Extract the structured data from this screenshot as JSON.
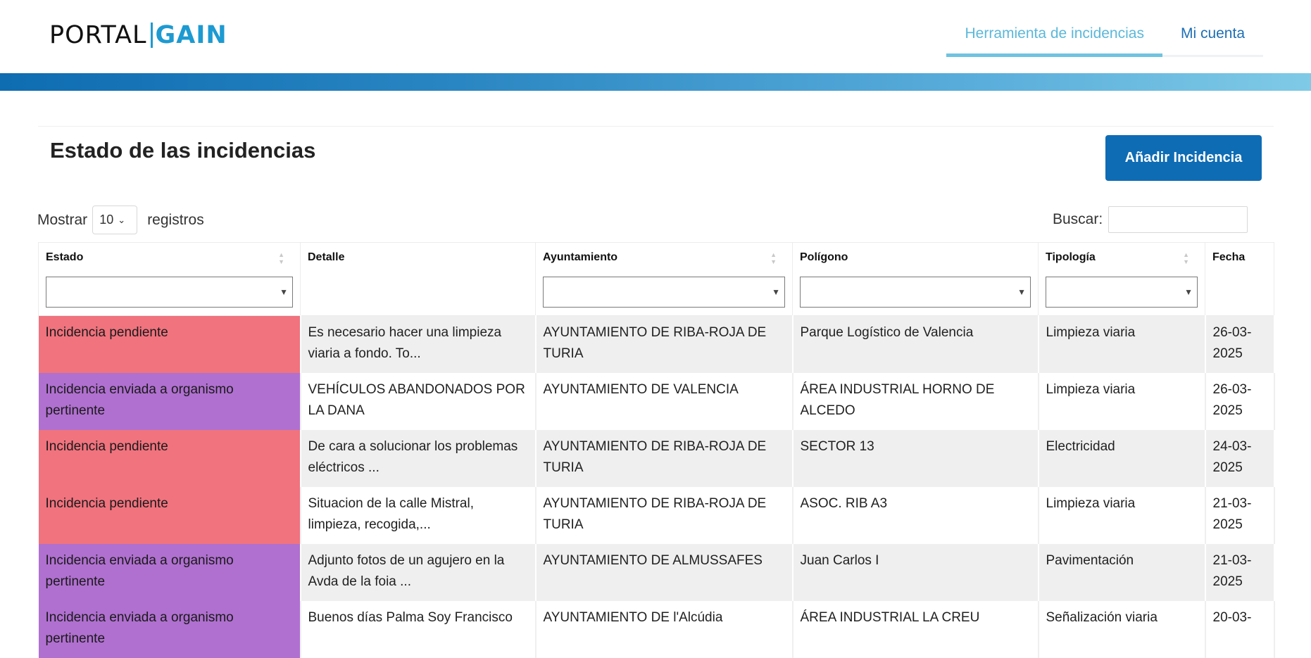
{
  "header": {
    "logo_left": "PORTAL",
    "logo_right": "GAIN",
    "nav": [
      {
        "label": "Herramienta de incidencias",
        "active": true
      },
      {
        "label": "Mi cuenta",
        "active": false
      }
    ]
  },
  "page": {
    "title": "Estado de las incidencias",
    "add_button": "Añadir Incidencia"
  },
  "table_controls": {
    "show_label": "Mostrar",
    "page_size": "10",
    "records_label": "registros",
    "search_label": "Buscar:",
    "search_value": ""
  },
  "columns": [
    "Estado",
    "Detalle",
    "Ayuntamiento",
    "Polígono",
    "Tipología",
    "Fecha"
  ],
  "status_colors": {
    "pendiente": "#f0737e",
    "enviada": "#b070d0"
  },
  "rows": [
    {
      "estado": "Incidencia pendiente",
      "status": "pendiente",
      "detalle": "Es necesario hacer una limpieza viaria a fondo. To...",
      "ayuntamiento": "AYUNTAMIENTO DE RIBA-ROJA DE TURIA",
      "poligono": "Parque Logístico de Valencia",
      "tipologia": "Limpieza viaria",
      "fecha": "26-03-2025"
    },
    {
      "estado": "Incidencia enviada a organismo pertinente",
      "status": "enviada",
      "detalle": "VEHÍCULOS ABANDONADOS POR LA DANA",
      "ayuntamiento": "AYUNTAMIENTO DE VALENCIA",
      "poligono": "ÁREA INDUSTRIAL HORNO DE ALCEDO",
      "tipologia": "Limpieza viaria",
      "fecha": "26-03-2025"
    },
    {
      "estado": "Incidencia pendiente",
      "status": "pendiente",
      "detalle": "De cara a solucionar los problemas eléctricos ...",
      "ayuntamiento": "AYUNTAMIENTO DE RIBA-ROJA DE TURIA",
      "poligono": "SECTOR 13",
      "tipologia": "Electricidad",
      "fecha": "24-03-2025"
    },
    {
      "estado": "Incidencia pendiente",
      "status": "pendiente",
      "detalle": "Situacion de la calle Mistral, limpieza, recogida,...",
      "ayuntamiento": "AYUNTAMIENTO DE RIBA-ROJA DE TURIA",
      "poligono": "ASOC. RIB A3",
      "tipologia": "Limpieza viaria",
      "fecha": "21-03-2025"
    },
    {
      "estado": "Incidencia enviada a organismo pertinente",
      "status": "enviada",
      "detalle": "Adjunto fotos de un agujero en la Avda de la foia ...",
      "ayuntamiento": "AYUNTAMIENTO DE ALMUSSAFES",
      "poligono": "Juan Carlos I",
      "tipologia": "Pavimentación",
      "fecha": "21-03-2025"
    },
    {
      "estado": "Incidencia enviada a organismo pertinente",
      "status": "enviada",
      "detalle": "Buenos días Palma Soy Francisco",
      "ayuntamiento": "AYUNTAMIENTO DE l'Alcúdia",
      "poligono": "ÁREA INDUSTRIAL LA CREU",
      "tipologia": "Señalización viaria",
      "fecha": "20-03-"
    }
  ]
}
